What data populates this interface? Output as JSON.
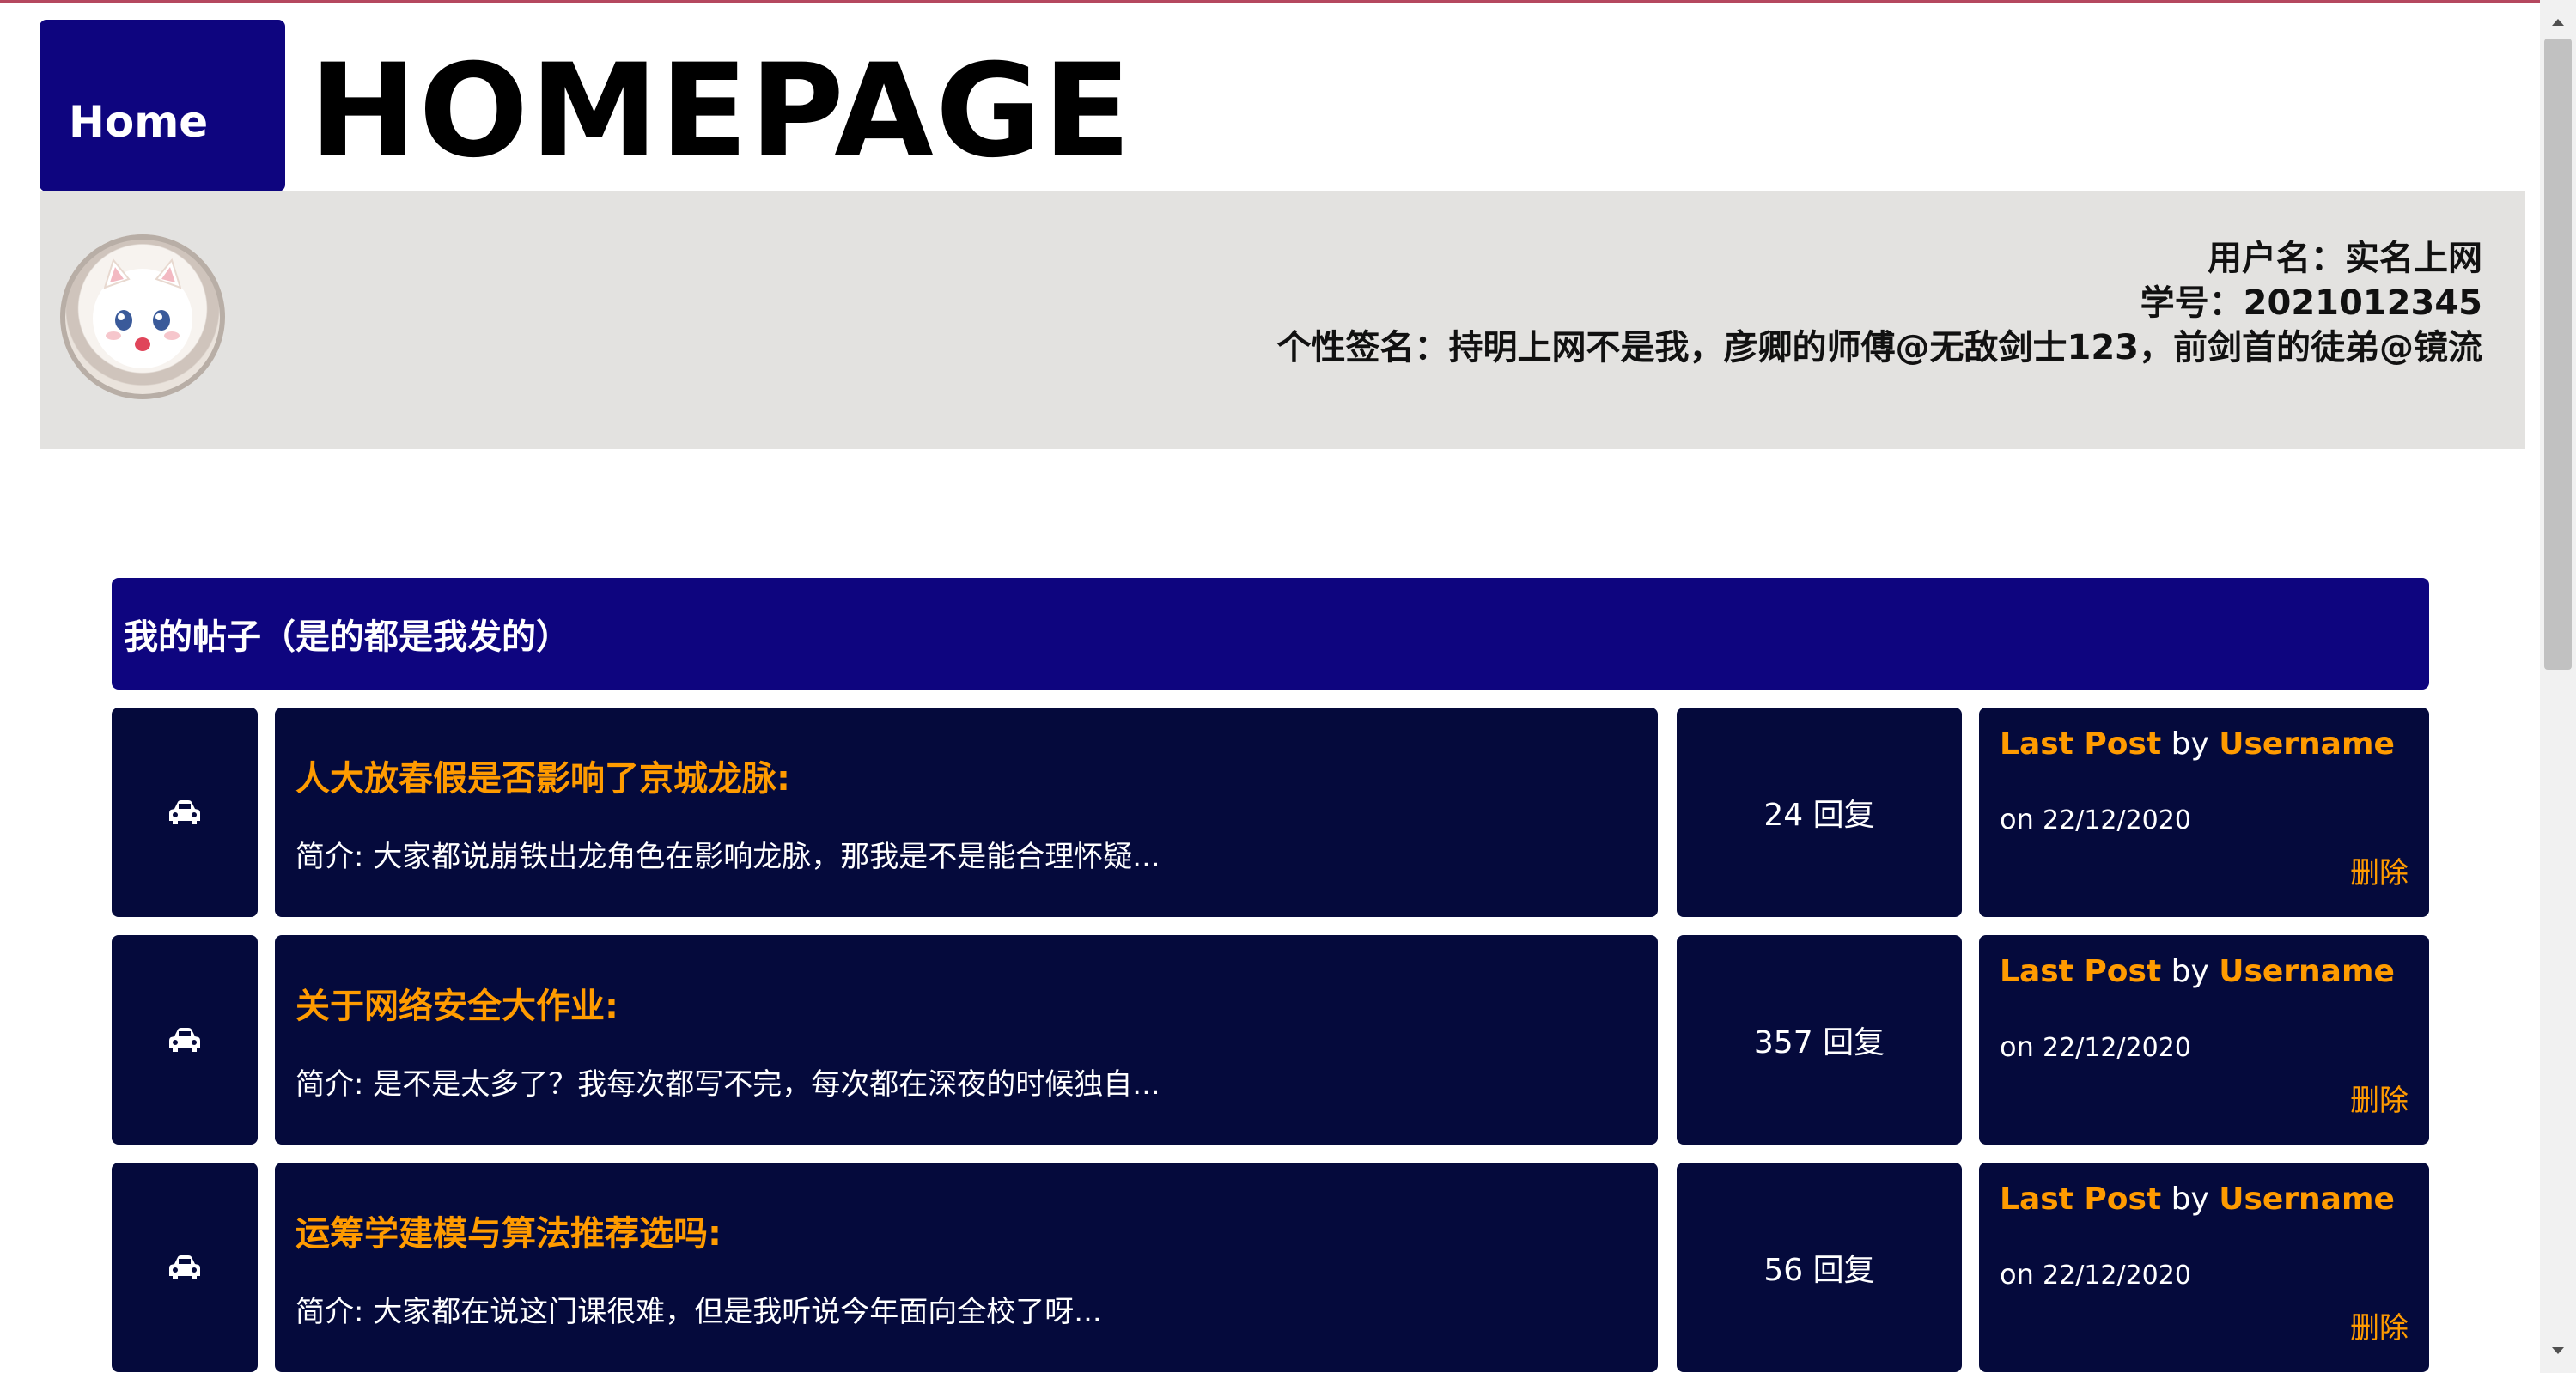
{
  "header": {
    "home_label": "Home",
    "site_title": "HOMEPAGE"
  },
  "profile": {
    "username": "用户名：实名上网",
    "student_id": "学号：2021012345",
    "signature": "个性签名：持明上网不是我，彦卿的师傅@无敌剑士123，前剑首的徒弟@镜流"
  },
  "section": {
    "title": "我的帖子（是的都是我发的）"
  },
  "posts": [
    {
      "icon": "car-icon",
      "title": "人大放春假是否影响了京城龙脉:",
      "summary": "简介: 大家都说崩铁出龙角色在影响龙脉，那我是不是能合理怀疑...",
      "replies": "24 回复",
      "last_post_label": "Last Post",
      "by": "by",
      "username": "Username",
      "on": "on",
      "date": "22/12/2020",
      "delete_label": "删除"
    },
    {
      "icon": "car-icon",
      "title": "关于网络安全大作业:",
      "summary": "简介: 是不是太多了？我每次都写不完，每次都在深夜的时候独自...",
      "replies": "357 回复",
      "last_post_label": "Last Post",
      "by": "by",
      "username": "Username",
      "on": "on",
      "date": "22/12/2020",
      "delete_label": "删除"
    },
    {
      "icon": "car-icon",
      "title": "运筹学建模与算法推荐选吗:",
      "summary": "简介: 大家都在说这门课很难，但是我听说今年面向全校了呀...",
      "replies": "56 回复",
      "last_post_label": "Last Post",
      "by": "by",
      "username": "Username",
      "on": "on",
      "date": "22/12/2020",
      "delete_label": "删除"
    }
  ],
  "colors": {
    "nav_blue": "#0e057f",
    "card_bg": "#050a3c",
    "accent_orange": "#ff9b00",
    "profile_bg": "#e3e2e0"
  }
}
